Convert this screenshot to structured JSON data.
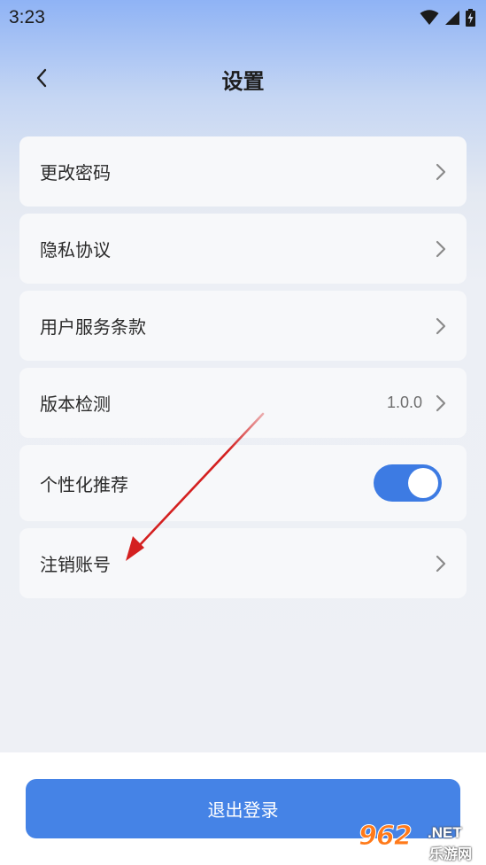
{
  "status_bar": {
    "time": "3:23",
    "icons": [
      "wifi-icon",
      "signal-icon",
      "battery-charging-icon"
    ]
  },
  "header": {
    "back_icon": "chevron-left-icon",
    "title": "设置"
  },
  "settings": {
    "change_password": {
      "label": "更改密码"
    },
    "privacy_policy": {
      "label": "隐私协议"
    },
    "terms_of_service": {
      "label": "用户服务条款"
    },
    "version_check": {
      "label": "版本检测",
      "value": "1.0.0"
    },
    "personalized_recommendation": {
      "label": "个性化推荐",
      "toggle_on": true
    },
    "delete_account": {
      "label": "注销账号"
    }
  },
  "footer": {
    "logout_label": "退出登录"
  },
  "watermark": {
    "logo_text": "962",
    "net_text": ".NET",
    "site_text": "乐游网"
  },
  "colors": {
    "accent": "#4583e6",
    "toggle": "#3d7be3",
    "annotation_arrow": "#d42020"
  }
}
